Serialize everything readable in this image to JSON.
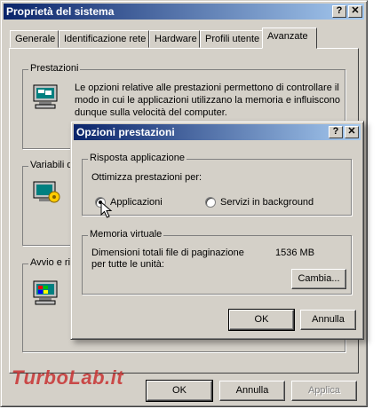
{
  "main_window": {
    "title": "Proprietà del sistema",
    "help_btn": "?",
    "close_btn": "✕",
    "tabs": [
      {
        "label": "Generale"
      },
      {
        "label": "Identificazione rete"
      },
      {
        "label": "Hardware"
      },
      {
        "label": "Profili utente"
      },
      {
        "label": "Avanzate"
      }
    ],
    "groups": {
      "prestazioni": {
        "label": "Prestazioni",
        "line1": "Le opzioni relative alle prestazioni permettono di controllare il",
        "line2": "modo in cui le applicazioni utilizzano la memoria e influiscono",
        "line3": "dunque sulla velocità del computer."
      },
      "variabili": {
        "label": "Variabili d'"
      },
      "avvio": {
        "label": "Avvio e rip"
      }
    },
    "buttons": {
      "ok": "OK",
      "annulla": "Annulla",
      "applica": "Applica"
    }
  },
  "dialog": {
    "title": "Opzioni prestazioni",
    "help_btn": "?",
    "close_btn": "✕",
    "risposta": {
      "label": "Risposta applicazione",
      "prompt": "Ottimizza prestazioni per:",
      "option_app": "Applicazioni",
      "option_bg": "Servizi in background"
    },
    "memoria": {
      "label": "Memoria virtuale",
      "line1": "Dimensioni totali file di paginazione",
      "line2": "per tutte le unità:",
      "value": "1536 MB",
      "cambia": "Cambia..."
    },
    "buttons": {
      "ok": "OK",
      "annulla": "Annulla"
    }
  },
  "watermark": "TurboLab.it"
}
